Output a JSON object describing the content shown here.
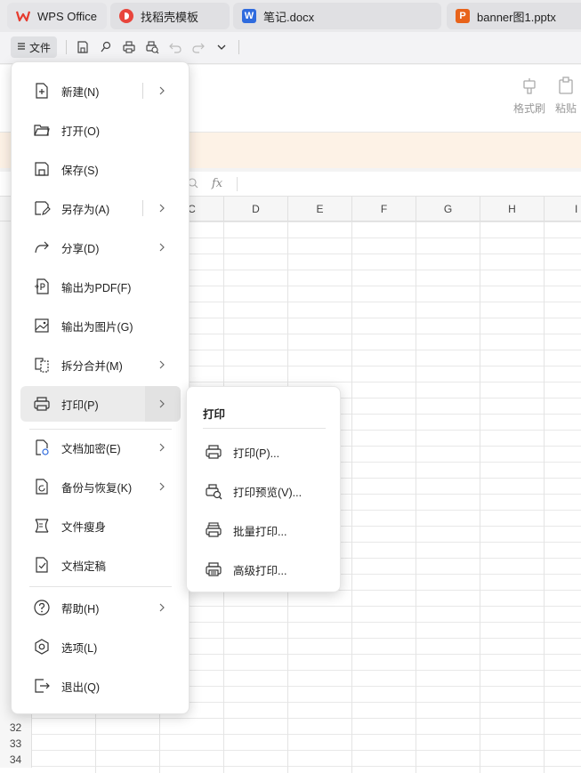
{
  "tabs": [
    {
      "label": "WPS Office",
      "icon": "wps-logo-icon",
      "color": "#e63b2e"
    },
    {
      "label": "找稻壳模板",
      "icon": "docer-logo-icon",
      "color": "#e8453c"
    },
    {
      "label": "笔记.docx",
      "icon": "word-doc-icon",
      "color": "#2f6bde",
      "glyph": "W"
    },
    {
      "label": "banner图1.pptx",
      "icon": "ppt-doc-icon",
      "color": "#e8631a",
      "glyph": "P"
    }
  ],
  "toolbar": {
    "file_label": "文件"
  },
  "ribbon": {
    "format_painter": "格式刷",
    "paste": "粘贴"
  },
  "formula": {
    "fx": "fx"
  },
  "sheet": {
    "columns": [
      "C",
      "D",
      "E",
      "F",
      "G",
      "H",
      "I"
    ],
    "rows": [
      "32",
      "33",
      "34"
    ]
  },
  "file_menu": {
    "items": [
      {
        "label": "新建(N)",
        "icon": "new-file-icon",
        "submenu": true,
        "split": true
      },
      {
        "label": "打开(O)",
        "icon": "open-folder-icon",
        "submenu": false
      },
      {
        "label": "保存(S)",
        "icon": "save-icon",
        "submenu": false
      },
      {
        "label": "另存为(A)",
        "icon": "save-as-icon",
        "submenu": true,
        "split": true
      },
      {
        "label": "分享(D)",
        "icon": "share-icon",
        "submenu": true
      },
      {
        "label": "输出为PDF(F)",
        "icon": "export-pdf-icon",
        "submenu": false
      },
      {
        "label": "输出为图片(G)",
        "icon": "export-image-icon",
        "submenu": false
      },
      {
        "label": "拆分合并(M)",
        "icon": "split-merge-icon",
        "submenu": true
      },
      {
        "label": "打印(P)",
        "icon": "printer-icon",
        "submenu": true,
        "active": true
      },
      {
        "label": "文档加密(E)",
        "icon": "encrypt-doc-icon",
        "submenu": true
      },
      {
        "label": "备份与恢复(K)",
        "icon": "backup-restore-icon",
        "submenu": true
      },
      {
        "label": "文件瘦身",
        "icon": "file-slim-icon",
        "submenu": false
      },
      {
        "label": "文档定稿",
        "icon": "finalize-doc-icon",
        "submenu": false
      },
      {
        "label": "帮助(H)",
        "icon": "help-icon",
        "submenu": true
      },
      {
        "label": "选项(L)",
        "icon": "options-icon",
        "submenu": false
      },
      {
        "label": "退出(Q)",
        "icon": "exit-icon",
        "submenu": false
      }
    ]
  },
  "print_submenu": {
    "title": "打印",
    "items": [
      {
        "label": "打印(P)...",
        "icon": "printer-icon"
      },
      {
        "label": "打印预览(V)...",
        "icon": "print-preview-icon"
      },
      {
        "label": "批量打印...",
        "icon": "batch-print-icon"
      },
      {
        "label": "高级打印...",
        "icon": "advanced-print-icon"
      }
    ]
  }
}
